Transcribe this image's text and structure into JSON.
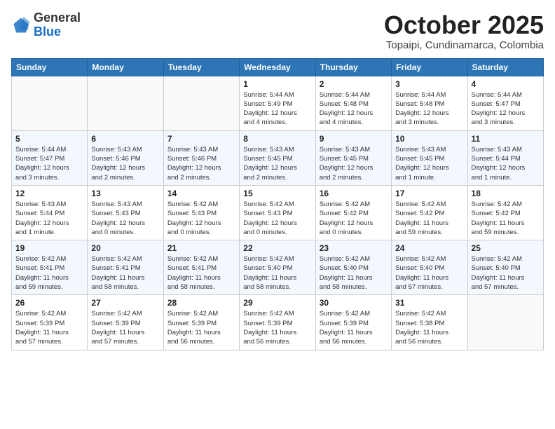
{
  "header": {
    "logo_general": "General",
    "logo_blue": "Blue",
    "month_title": "October 2025",
    "subtitle": "Topaipi, Cundinamarca, Colombia"
  },
  "days_of_week": [
    "Sunday",
    "Monday",
    "Tuesday",
    "Wednesday",
    "Thursday",
    "Friday",
    "Saturday"
  ],
  "weeks": [
    [
      {
        "day": "",
        "info": ""
      },
      {
        "day": "",
        "info": ""
      },
      {
        "day": "",
        "info": ""
      },
      {
        "day": "1",
        "info": "Sunrise: 5:44 AM\nSunset: 5:49 PM\nDaylight: 12 hours\nand 4 minutes."
      },
      {
        "day": "2",
        "info": "Sunrise: 5:44 AM\nSunset: 5:48 PM\nDaylight: 12 hours\nand 4 minutes."
      },
      {
        "day": "3",
        "info": "Sunrise: 5:44 AM\nSunset: 5:48 PM\nDaylight: 12 hours\nand 3 minutes."
      },
      {
        "day": "4",
        "info": "Sunrise: 5:44 AM\nSunset: 5:47 PM\nDaylight: 12 hours\nand 3 minutes."
      }
    ],
    [
      {
        "day": "5",
        "info": "Sunrise: 5:44 AM\nSunset: 5:47 PM\nDaylight: 12 hours\nand 3 minutes."
      },
      {
        "day": "6",
        "info": "Sunrise: 5:43 AM\nSunset: 5:46 PM\nDaylight: 12 hours\nand 2 minutes."
      },
      {
        "day": "7",
        "info": "Sunrise: 5:43 AM\nSunset: 5:46 PM\nDaylight: 12 hours\nand 2 minutes."
      },
      {
        "day": "8",
        "info": "Sunrise: 5:43 AM\nSunset: 5:45 PM\nDaylight: 12 hours\nand 2 minutes."
      },
      {
        "day": "9",
        "info": "Sunrise: 5:43 AM\nSunset: 5:45 PM\nDaylight: 12 hours\nand 2 minutes."
      },
      {
        "day": "10",
        "info": "Sunrise: 5:43 AM\nSunset: 5:45 PM\nDaylight: 12 hours\nand 1 minute."
      },
      {
        "day": "11",
        "info": "Sunrise: 5:43 AM\nSunset: 5:44 PM\nDaylight: 12 hours\nand 1 minute."
      }
    ],
    [
      {
        "day": "12",
        "info": "Sunrise: 5:43 AM\nSunset: 5:44 PM\nDaylight: 12 hours\nand 1 minute."
      },
      {
        "day": "13",
        "info": "Sunrise: 5:43 AM\nSunset: 5:43 PM\nDaylight: 12 hours\nand 0 minutes."
      },
      {
        "day": "14",
        "info": "Sunrise: 5:42 AM\nSunset: 5:43 PM\nDaylight: 12 hours\nand 0 minutes."
      },
      {
        "day": "15",
        "info": "Sunrise: 5:42 AM\nSunset: 5:43 PM\nDaylight: 12 hours\nand 0 minutes."
      },
      {
        "day": "16",
        "info": "Sunrise: 5:42 AM\nSunset: 5:42 PM\nDaylight: 12 hours\nand 0 minutes."
      },
      {
        "day": "17",
        "info": "Sunrise: 5:42 AM\nSunset: 5:42 PM\nDaylight: 11 hours\nand 59 minutes."
      },
      {
        "day": "18",
        "info": "Sunrise: 5:42 AM\nSunset: 5:42 PM\nDaylight: 11 hours\nand 59 minutes."
      }
    ],
    [
      {
        "day": "19",
        "info": "Sunrise: 5:42 AM\nSunset: 5:41 PM\nDaylight: 11 hours\nand 59 minutes."
      },
      {
        "day": "20",
        "info": "Sunrise: 5:42 AM\nSunset: 5:41 PM\nDaylight: 11 hours\nand 58 minutes."
      },
      {
        "day": "21",
        "info": "Sunrise: 5:42 AM\nSunset: 5:41 PM\nDaylight: 11 hours\nand 58 minutes."
      },
      {
        "day": "22",
        "info": "Sunrise: 5:42 AM\nSunset: 5:40 PM\nDaylight: 11 hours\nand 58 minutes."
      },
      {
        "day": "23",
        "info": "Sunrise: 5:42 AM\nSunset: 5:40 PM\nDaylight: 11 hours\nand 58 minutes."
      },
      {
        "day": "24",
        "info": "Sunrise: 5:42 AM\nSunset: 5:40 PM\nDaylight: 11 hours\nand 57 minutes."
      },
      {
        "day": "25",
        "info": "Sunrise: 5:42 AM\nSunset: 5:40 PM\nDaylight: 11 hours\nand 57 minutes."
      }
    ],
    [
      {
        "day": "26",
        "info": "Sunrise: 5:42 AM\nSunset: 5:39 PM\nDaylight: 11 hours\nand 57 minutes."
      },
      {
        "day": "27",
        "info": "Sunrise: 5:42 AM\nSunset: 5:39 PM\nDaylight: 11 hours\nand 57 minutes."
      },
      {
        "day": "28",
        "info": "Sunrise: 5:42 AM\nSunset: 5:39 PM\nDaylight: 11 hours\nand 56 minutes."
      },
      {
        "day": "29",
        "info": "Sunrise: 5:42 AM\nSunset: 5:39 PM\nDaylight: 11 hours\nand 56 minutes."
      },
      {
        "day": "30",
        "info": "Sunrise: 5:42 AM\nSunset: 5:39 PM\nDaylight: 11 hours\nand 56 minutes."
      },
      {
        "day": "31",
        "info": "Sunrise: 5:42 AM\nSunset: 5:38 PM\nDaylight: 11 hours\nand 56 minutes."
      },
      {
        "day": "",
        "info": ""
      }
    ]
  ]
}
